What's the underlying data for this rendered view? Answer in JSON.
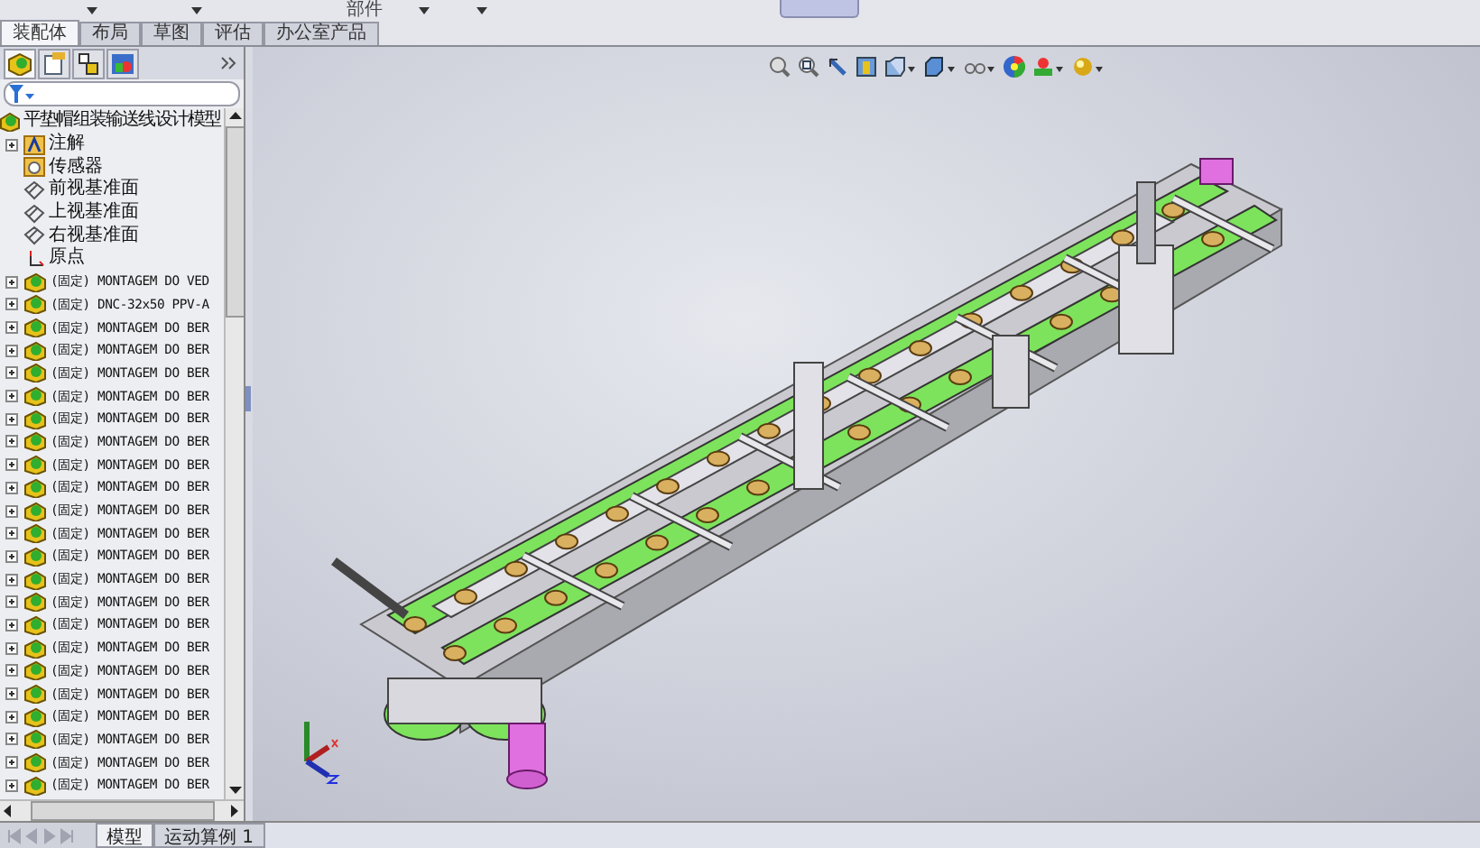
{
  "toolbar": {
    "label": "部件"
  },
  "tabs": [
    {
      "label": "装配体",
      "selected": true
    },
    {
      "label": "布局",
      "selected": false
    },
    {
      "label": "草图",
      "selected": false
    },
    {
      "label": "评估",
      "selected": false
    },
    {
      "label": "办公室产品",
      "selected": false
    }
  ],
  "feature_manager": {
    "panel_tabs": [
      {
        "kind": "tree",
        "selected": true
      },
      {
        "kind": "property",
        "selected": false
      },
      {
        "kind": "config",
        "selected": false
      },
      {
        "kind": "display",
        "selected": false
      }
    ],
    "tree": {
      "label": "平垫帽组装输送线设计模型",
      "kind": "assembly",
      "children": [
        {
          "label": "注解",
          "kind": "annotations",
          "expanded": false
        },
        {
          "label": "传感器",
          "kind": "sensors"
        },
        {
          "label": "前视基准面",
          "kind": "plane"
        },
        {
          "label": "上视基准面",
          "kind": "plane"
        },
        {
          "label": "右视基准面",
          "kind": "plane"
        },
        {
          "label": "原点",
          "kind": "origin"
        },
        {
          "label": "(固定) MONTAGEM DO VED",
          "kind": "part",
          "expanded": false
        },
        {
          "label": "(固定) DNC-32x50 PPV-A",
          "kind": "part",
          "expanded": false
        },
        {
          "label": "(固定) MONTAGEM DO BER",
          "kind": "part",
          "expanded": false
        },
        {
          "label": "(固定) MONTAGEM DO BER",
          "kind": "part",
          "expanded": false
        },
        {
          "label": "(固定) MONTAGEM DO BER",
          "kind": "part",
          "expanded": false
        },
        {
          "label": "(固定) MONTAGEM DO BER",
          "kind": "part",
          "expanded": false
        },
        {
          "label": "(固定) MONTAGEM DO BER",
          "kind": "part",
          "expanded": false
        },
        {
          "label": "(固定) MONTAGEM DO BER",
          "kind": "part",
          "expanded": false
        },
        {
          "label": "(固定) MONTAGEM DO BER",
          "kind": "part",
          "expanded": false
        },
        {
          "label": "(固定) MONTAGEM DO BER",
          "kind": "part",
          "expanded": false
        },
        {
          "label": "(固定) MONTAGEM DO BER",
          "kind": "part",
          "expanded": false
        },
        {
          "label": "(固定) MONTAGEM DO BER",
          "kind": "part",
          "expanded": false
        },
        {
          "label": "(固定) MONTAGEM DO BER",
          "kind": "part",
          "expanded": false
        },
        {
          "label": "(固定) MONTAGEM DO BER",
          "kind": "part",
          "expanded": false
        },
        {
          "label": "(固定) MONTAGEM DO BER",
          "kind": "part",
          "expanded": false
        },
        {
          "label": "(固定) MONTAGEM DO BER",
          "kind": "part",
          "expanded": false
        },
        {
          "label": "(固定) MONTAGEM DO BER",
          "kind": "part",
          "expanded": false
        },
        {
          "label": "(固定) MONTAGEM DO BER",
          "kind": "part",
          "expanded": false
        },
        {
          "label": "(固定) MONTAGEM DO BER",
          "kind": "part",
          "expanded": false
        },
        {
          "label": "(固定) MONTAGEM DO BER",
          "kind": "part",
          "expanded": false
        },
        {
          "label": "(固定) MONTAGEM DO BER",
          "kind": "part",
          "expanded": false
        },
        {
          "label": "(固定) MONTAGEM DO BER",
          "kind": "part",
          "expanded": false
        },
        {
          "label": "(固定) MONTAGEM DO BER",
          "kind": "part",
          "expanded": false
        }
      ]
    }
  },
  "bottom_tabs": [
    {
      "label": "模型",
      "selected": true
    },
    {
      "label": "运动算例 1",
      "selected": false
    }
  ]
}
